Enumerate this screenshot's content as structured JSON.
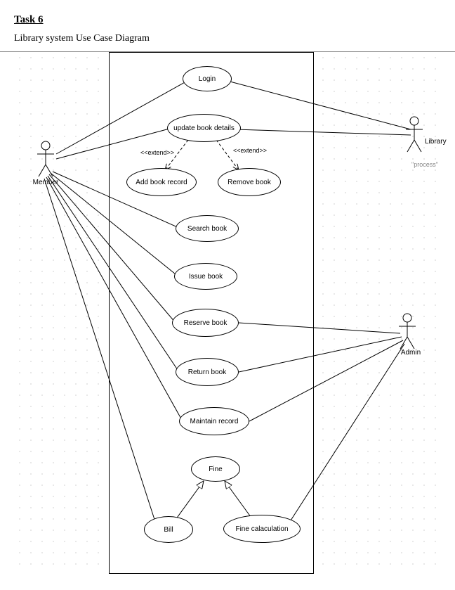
{
  "header": {
    "title": "Task 6",
    "subtitle": "Library system Use Case Diagram"
  },
  "actors": {
    "member": "Member",
    "library": "Library",
    "admin": "Admin",
    "process": "\"process\""
  },
  "usecases": {
    "login": "Login",
    "update_book": "update book details",
    "add_book": "Add book record",
    "remove_book": "Remove book",
    "search_book": "Search book",
    "issue_book": "Issue book",
    "reserve_book": "Reserve book",
    "return_book": "Return book",
    "maintain_record": "Maintain record",
    "fine": "Fine",
    "bill": "Bill",
    "fine_calc": "Fine calaculation"
  },
  "stereotypes": {
    "extend1": "<<extend>>",
    "extend2": "<<extend>>"
  },
  "chart_data": {
    "type": "uml-use-case",
    "title": "Library system Use Case Diagram",
    "actors": [
      "Member",
      "Library",
      "Admin"
    ],
    "use_cases": [
      "Login",
      "update book details",
      "Add book record",
      "Remove book",
      "Search book",
      "Issue book",
      "Reserve book",
      "Return book",
      "Maintain record",
      "Fine",
      "Bill",
      "Fine calaculation"
    ],
    "associations": [
      [
        "Member",
        "Login"
      ],
      [
        "Library",
        "Login"
      ],
      [
        "Member",
        "update book details"
      ],
      [
        "Library",
        "update book details"
      ],
      [
        "Member",
        "Search book"
      ],
      [
        "Member",
        "Issue book"
      ],
      [
        "Member",
        "Reserve book"
      ],
      [
        "Member",
        "Return book"
      ],
      [
        "Member",
        "Maintain record"
      ],
      [
        "Member",
        "Bill"
      ],
      [
        "Admin",
        "Reserve book"
      ],
      [
        "Admin",
        "Return book"
      ],
      [
        "Admin",
        "Maintain record"
      ],
      [
        "Admin",
        "Fine calaculation"
      ]
    ],
    "extends": [
      [
        "Add book record",
        "update book details"
      ],
      [
        "Remove book",
        "update book details"
      ]
    ],
    "generalizations": [
      [
        "Bill",
        "Fine"
      ],
      [
        "Fine calaculation",
        "Fine"
      ]
    ]
  }
}
